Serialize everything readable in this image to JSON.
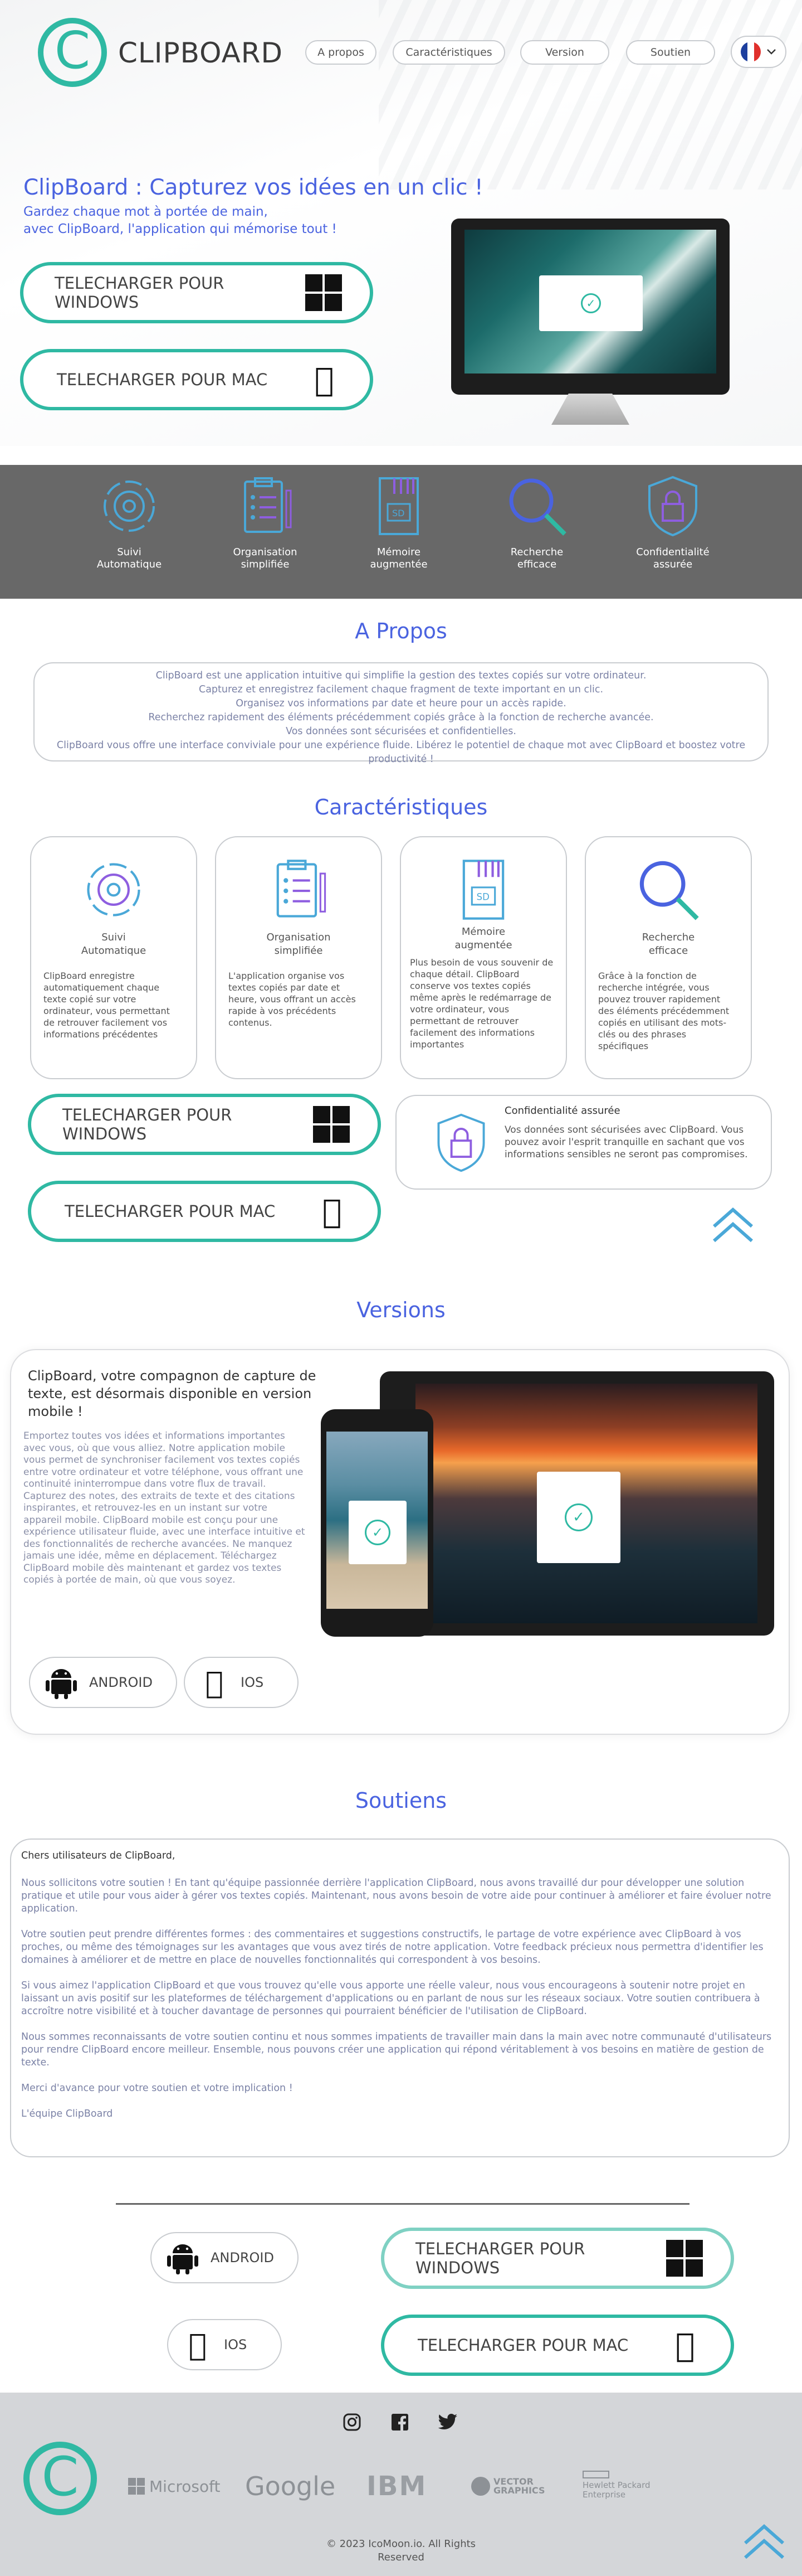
{
  "header": {
    "logo_text": "CLIPBOARD",
    "nav": [
      "A propos",
      "Caractéristiques",
      "Version",
      "Soutien"
    ],
    "lang": "fr"
  },
  "hero": {
    "title": "ClipBoard : Capturez vos idées en un clic !",
    "subtitle_line1": "Gardez chaque mot à portée de main,",
    "subtitle_line2": "avec ClipBoard, l'application qui mémorise tout !",
    "btn_windows": "TELECHARGER POUR WINDOWS",
    "btn_mac": "TELECHARGER POUR MAC"
  },
  "band": [
    {
      "l1": "Suivi",
      "l2": "Automatique",
      "icon": "gear-cycle-icon"
    },
    {
      "l1": "Organisation",
      "l2": "simplifiée",
      "icon": "clipboard-list-icon"
    },
    {
      "l1": "Mémoire",
      "l2": "augmentée",
      "icon": "sd-card-icon"
    },
    {
      "l1": "Recherche",
      "l2": "efficace",
      "icon": "magnifier-icon"
    },
    {
      "l1": "Confidentialité",
      "l2": "assurée",
      "icon": "shield-lock-icon"
    }
  ],
  "apropos": {
    "title": "A Propos",
    "lines": [
      "ClipBoard est une application intuitive qui simplifie la gestion des textes copiés sur votre ordinateur.",
      "Capturez et enregistrez facilement chaque fragment de texte important en un clic.",
      "Organisez vos informations par date et heure pour un accès rapide.",
      "Recherchez rapidement des éléments précédemment copiés grâce à la fonction de recherche avancée.",
      "Vos données sont sécurisées et confidentielles.",
      "ClipBoard vous offre une interface conviviale pour une expérience fluide. Libérez le potentiel de chaque mot avec ClipBoard et boostez votre productivité !"
    ]
  },
  "features": {
    "title": "Caractéristiques",
    "cards": [
      {
        "l1": "Suivi",
        "l2": "Automatique",
        "body": "ClipBoard enregistre automatiquement chaque texte copié sur votre ordinateur, vous permettant de retrouver facilement vos informations précédentes"
      },
      {
        "l1": "Organisation",
        "l2": "simplifiée",
        "body": "L'application organise vos textes copiés par date et heure, vous offrant un accès rapide à vos précédents contenus."
      },
      {
        "l1": "Mémoire",
        "l2": "augmentée",
        "body": "Plus besoin de vous souvenir de chaque détail. ClipBoard conserve vos textes copiés même après le redémarrage de votre ordinateur, vous permettant de retrouver facilement des informations importantes"
      },
      {
        "l1": "Recherche",
        "l2": "efficace",
        "body": "Grâce à la fonction de recherche intégrée, vous pouvez trouver rapidement des éléments précédemment copiés en utilisant des mots-clés ou des phrases spécifiques"
      }
    ],
    "conf_title": "Confidentialité assurée",
    "conf_body": "Vos données sont sécurisées avec ClipBoard. Vous pouvez avoir l'esprit tranquille en sachant que vos informations sensibles ne seront pas compromises.",
    "btn_windows": "TELECHARGER POUR WINDOWS",
    "btn_mac": "TELECHARGER POUR MAC"
  },
  "versions": {
    "title": "Versions",
    "heading": "ClipBoard, votre compagnon de capture de texte, est désormais disponible en version mobile !",
    "body": "Emportez toutes vos idées et informations importantes avec vous, où que vous alliez. Notre application mobile vous permet de synchroniser facilement vos textes copiés entre votre ordinateur et votre téléphone, vous offrant une continuité ininterrompue dans votre flux de travail. Capturez des notes, des extraits de texte et des citations inspirantes, et retrouvez-les en un instant sur votre appareil mobile. ClipBoard mobile est conçu pour une expérience utilisateur fluide, avec une interface intuitive et des fonctionnalités de recherche avancées. Ne manquez jamais une idée, même en déplacement. Téléchargez ClipBoard mobile dès maintenant et gardez vos textes copiés à portée de main, où que vous soyez.",
    "android": "ANDROID",
    "ios": "IOS"
  },
  "soutiens": {
    "title": "Soutiens",
    "greeting": "Chers utilisateurs de ClipBoard,",
    "p1": "Nous sollicitons votre soutien ! En tant qu'équipe passionnée derrière l'application ClipBoard, nous avons travaillé dur pour développer une solution pratique et utile pour vous aider à gérer vos textes copiés. Maintenant, nous avons besoin de votre aide pour continuer à améliorer et faire évoluer notre application.",
    "p2": "Votre soutien peut prendre différentes formes : des commentaires et suggestions constructifs, le partage de votre expérience avec ClipBoard à vos proches, ou même des témoignages sur les avantages que vous avez tirés de notre application. Votre feedback précieux nous permettra d'identifier les domaines à améliorer et de mettre en place de nouvelles fonctionnalités qui correspondent à vos besoins.",
    "p3": "Si vous aimez l'application ClipBoard et que vous trouvez qu'elle vous apporte une réelle valeur, nous vous encourageons à soutenir notre projet en laissant un avis positif sur les plateformes de téléchargement d'applications ou en parlant de nous sur les réseaux sociaux. Votre soutien contribuera à accroître notre visibilité et à toucher davantage de personnes qui pourraient bénéficier de l'utilisation de ClipBoard.",
    "p4": "Nous sommes reconnaissants de votre soutien continu et nous sommes impatients de travailler main dans la main avec notre communauté d'utilisateurs pour rendre ClipBoard encore meilleur. Ensemble, nous pouvons créer une application qui répond véritablement à vos besoins en matière de gestion de texte.",
    "p5": "Merci d'avance pour votre soutien et votre implication !",
    "sign": "L'équipe ClipBoard"
  },
  "downloads": {
    "android": "ANDROID",
    "ios": "IOS",
    "btn_windows": "TELECHARGER POUR WINDOWS",
    "btn_mac": "TELECHARGER POUR MAC"
  },
  "footer": {
    "brands": [
      "Microsoft",
      "Google",
      "IBM",
      "VECTOR GRAPHICS",
      "Hewlett Packard Enterprise"
    ],
    "copy_line1": "© 2023 IcoMoon.io. All Rights",
    "copy_line2": "Reserved"
  },
  "colors": {
    "accent": "#2fb9a3",
    "title_blue": "#4a63e0",
    "band_grey": "#686868",
    "footer_grey": "#d4d6d9"
  }
}
